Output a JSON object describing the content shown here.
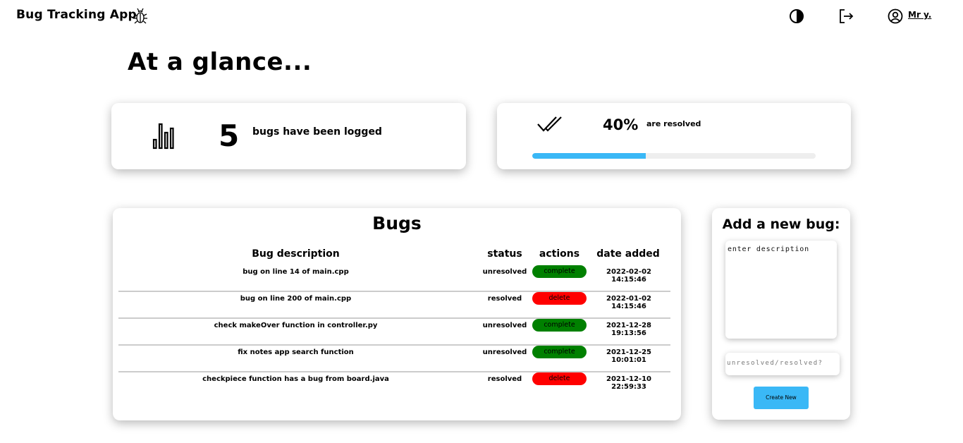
{
  "navbar": {
    "brand": "Bug Tracking App",
    "brand_icon": "bug-icon",
    "theme_icon": "contrast-icon",
    "logout_icon": "logout-icon",
    "user_icon": "user-circle-icon",
    "user_label": "Mr y."
  },
  "heading": "At a glance...",
  "stats": {
    "count_icon": "bar-chart-icon",
    "count": "5",
    "count_label": "bugs have been logged",
    "resolved_icon": "double-check-icon",
    "resolved_percent": "40%",
    "resolved_label": "are resolved",
    "resolved_fraction": 0.4,
    "progress_color": "#3ab8f6"
  },
  "bugs": {
    "title": "Bugs",
    "headers": [
      "Bug description",
      "status",
      "actions",
      "date added"
    ],
    "rows": [
      {
        "description": "bug on line 14 of main.cpp",
        "status": "unresolved",
        "action": "complete",
        "date": "2022-02-02 14:15:46"
      },
      {
        "description": "bug on line 200 of main.cpp",
        "status": "resolved",
        "action": "delete",
        "date": "2022-01-02 14:15:46"
      },
      {
        "description": "check makeOver function in controller.py",
        "status": "unresolved",
        "action": "complete",
        "date": "2021-12-28 19:13:56"
      },
      {
        "description": "fix notes app search function",
        "status": "unresolved",
        "action": "complete",
        "date": "2021-12-25 10:01:01"
      },
      {
        "description": "checkpiece function has a bug from board.java",
        "status": "resolved",
        "action": "delete",
        "date": "2021-12-10 22:59:33"
      }
    ],
    "colors": {
      "complete": "#008000",
      "delete": "#ff0000"
    }
  },
  "add_form": {
    "title": "Add a new bug:",
    "description_placeholder": "enter description",
    "status_placeholder": "unresolved/resolved?",
    "button_label": "Create New"
  }
}
